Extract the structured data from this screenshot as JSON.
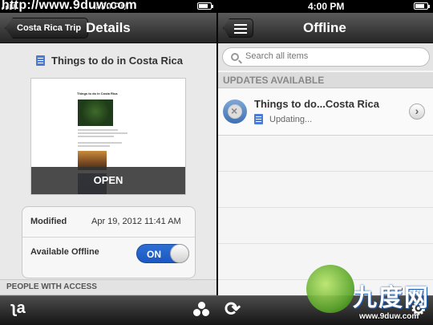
{
  "status_bar": {
    "watermark_url": "http://www.9duw.com",
    "left_time": "4:00 PM",
    "right_time": "4:00 PM"
  },
  "details": {
    "back_label": "Costa Rica Trip",
    "title": "Details",
    "doc_title": "Things to do in Costa Rica",
    "preview_title": "Things to do in Costa Rica",
    "open_label": "OPEN",
    "modified_label": "Modified",
    "modified_value": "Apr 19, 2012 11:41 AM",
    "offline_label": "Available Offline",
    "toggle_label": "ON",
    "toggle_on": true,
    "people_header": "PEOPLE WITH ACCESS"
  },
  "offline": {
    "title": "Offline",
    "search_placeholder": "Search all items",
    "section_header": "UPDATES AVAILABLE",
    "items": [
      {
        "title": "Things to do...Costa Rica",
        "status": "Updating..."
      }
    ]
  },
  "toolbar": {
    "sort_icon": "sort-alpha-icon",
    "share_icon": "share-people-icon",
    "sync_icon": "sync-icon",
    "settings_icon": "gear-icon"
  },
  "watermark": {
    "brand": "九度网",
    "url": "www.9duw.com"
  },
  "colors": {
    "toggle_blue": "#1b59c0",
    "doc_icon_blue": "#4a7bd6",
    "navbar_dark": "#262626"
  }
}
